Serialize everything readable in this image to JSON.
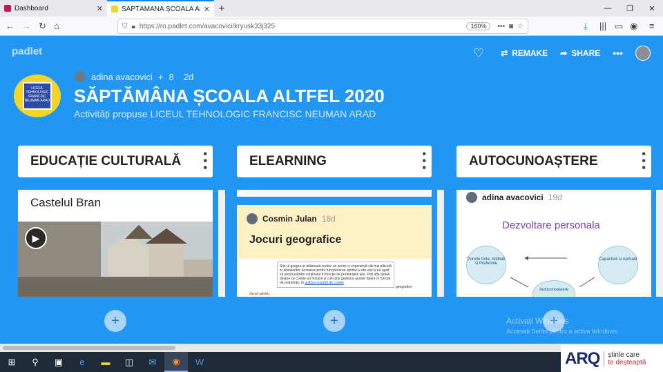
{
  "browser": {
    "tabs": [
      {
        "title": "Dashboard",
        "favicon_color": "#c2185b"
      },
      {
        "title": "SĂPTĂMÂNA ȘCOALA ALTFEL",
        "favicon_color": "#f5d426"
      }
    ],
    "url": "https://ro.padlet.com/avacovici/kryusk33j325",
    "zoom": "160%"
  },
  "padlet": {
    "logo": "padlet",
    "actions": {
      "remake": "REMAKE",
      "share": "SHARE"
    },
    "author": "adina avacovici",
    "contributors": "8",
    "age": "2d",
    "title": "SĂPTĂMÂNA ȘCOALA ALTFEL 2020",
    "subtitle": "Activități propuse LICEUL TEHNOLOGIC FRANCISC NEUMAN ARAD",
    "school_logo_text": "LICEUL TEHNOLOGIC FRANCISC NEUMAN ARAD"
  },
  "columns": [
    {
      "title": "EDUCAȚIE CULTURALĂ",
      "card_title": "Castelul Bran"
    },
    {
      "title": "ELEARNING",
      "card_author": "Cosmin Julan",
      "card_age": "18d",
      "card_title": "Jocuri geografice",
      "cookie_text": "Site-ul geogra.ro utilizează cookie-uri pentru o experiență cât mai plăcută a utilizatorilor. Accesea pentru funcționarea optimă a site-ului și ne ajută să personalizăm conținutul în funcție de preferințele tale. Poți afla detalii despre ce cookie-uri folosim și cum poți gestiona aceste fișiere în funcție de preferințe, în",
      "cookie_link": "politica noastră de cookie",
      "snippet_left": "Jocuri pentru",
      "snippet_right": "geografice"
    },
    {
      "title": "AUTOCUNOAȘTERE",
      "card_author": "adina avacovici",
      "card_age": "19d",
      "diagram_title": "Dezvoltare personala",
      "node_left": "Puncte forte, Abilitati si Preferinte",
      "node_right": "Capacitati si Aplicatii",
      "node_bottom": "Autocunoastere"
    }
  ],
  "watermark": {
    "line1": "Activați Windows",
    "line2": "Accesați Setări pentru a activa Windows."
  },
  "arq": {
    "brand": "ARQ",
    "line1": "știrile care",
    "line2": "te deșteaptă"
  }
}
